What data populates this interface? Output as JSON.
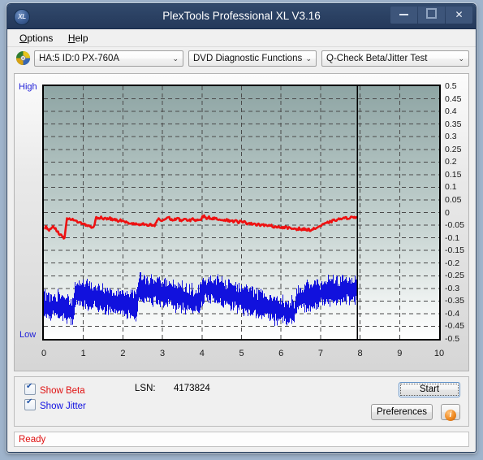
{
  "window": {
    "title": "PlexTools Professional XL V3.16",
    "app_icon": "xl-logo-icon",
    "minimize_label": "minimize",
    "maximize_label": "maximize",
    "close_label": "✕"
  },
  "menu": {
    "items": [
      {
        "label": "Options",
        "mnemonic": "O"
      },
      {
        "label": "Help",
        "mnemonic": "H"
      }
    ]
  },
  "toolbar": {
    "disc_icon": "disc-icon",
    "drive": {
      "value": "HA:5 ID:0  PX-760A",
      "arrow": "⌄"
    },
    "function": {
      "value": "DVD Diagnostic Functions",
      "arrow": "⌄"
    },
    "test": {
      "value": "Q-Check Beta/Jitter Test",
      "arrow": "⌄"
    }
  },
  "controls": {
    "show_beta": {
      "label": "Show Beta",
      "checked": true,
      "color": "#e01010"
    },
    "show_jitter": {
      "label": "Show Jitter",
      "checked": true,
      "color": "#1010e0"
    },
    "lsn_label": "LSN:",
    "lsn_value": "4173824",
    "start_label": "Start",
    "preferences_label": "Preferences",
    "info_label": "i"
  },
  "status": {
    "text": "Ready",
    "color": "#e01010"
  },
  "chart_data": {
    "type": "line",
    "title": "Q-Check Beta/Jitter Test",
    "xlabel": "",
    "ylabel": "",
    "xlim": [
      0,
      10
    ],
    "ylim": [
      -0.5,
      0.5
    ],
    "grid": true,
    "legend_position": "bottom-left",
    "axis_high_label": "High",
    "axis_low_label": "Low",
    "cursor_x": 7.93,
    "x_ticks": [
      "0",
      "1",
      "2",
      "3",
      "4",
      "5",
      "6",
      "7",
      "8",
      "9",
      "10"
    ],
    "y_ticks": [
      "0.5",
      "0.45",
      "0.4",
      "0.35",
      "0.3",
      "0.25",
      "0.2",
      "0.15",
      "0.1",
      "0.05",
      "0",
      "-0.05",
      "-0.1",
      "-0.15",
      "-0.2",
      "-0.25",
      "-0.3",
      "-0.35",
      "-0.4",
      "-0.45",
      "-0.5"
    ],
    "series": [
      {
        "name": "Beta",
        "color": "#ee1111",
        "x_start": 0.0,
        "x_end": 7.93,
        "values": [
          -0.062,
          -0.055,
          -0.071,
          -0.062,
          -0.052,
          -0.066,
          -0.078,
          -0.086,
          -0.095,
          -0.101,
          -0.027,
          -0.022,
          -0.026,
          -0.031,
          -0.034,
          -0.037,
          -0.04,
          -0.044,
          -0.048,
          -0.051,
          -0.054,
          -0.057,
          -0.059,
          -0.02,
          -0.023,
          -0.018,
          -0.024,
          -0.021,
          -0.026,
          -0.022,
          -0.028,
          -0.026,
          -0.031,
          -0.034,
          -0.03,
          -0.036,
          -0.038,
          -0.041,
          -0.042,
          -0.044,
          -0.045,
          -0.047,
          -0.048,
          -0.049,
          -0.046,
          -0.05,
          -0.052,
          -0.048,
          -0.051,
          -0.053,
          -0.03,
          -0.026,
          -0.033,
          -0.029,
          -0.024,
          -0.018,
          -0.026,
          -0.031,
          -0.027,
          -0.023,
          -0.028,
          -0.032,
          -0.025,
          -0.03,
          -0.034,
          -0.029,
          -0.024,
          -0.031,
          -0.028,
          -0.034,
          -0.018,
          -0.014,
          -0.022,
          -0.019,
          -0.025,
          -0.021,
          -0.027,
          -0.024,
          -0.029,
          -0.026,
          -0.031,
          -0.028,
          -0.034,
          -0.03,
          -0.036,
          -0.033,
          -0.038,
          -0.035,
          -0.04,
          -0.037,
          -0.043,
          -0.04,
          -0.046,
          -0.042,
          -0.048,
          -0.045,
          -0.051,
          -0.047,
          -0.053,
          -0.05,
          -0.055,
          -0.052,
          -0.057,
          -0.054,
          -0.059,
          -0.056,
          -0.061,
          -0.058,
          -0.063,
          -0.06,
          -0.065,
          -0.062,
          -0.066,
          -0.063,
          -0.068,
          -0.065,
          -0.069,
          -0.066,
          -0.07,
          -0.067,
          -0.063,
          -0.059,
          -0.055,
          -0.051,
          -0.047,
          -0.043,
          -0.039,
          -0.036,
          -0.033,
          -0.03,
          -0.028,
          -0.026,
          -0.024,
          -0.023,
          -0.022,
          -0.021,
          -0.02,
          -0.019,
          -0.018,
          -0.017
        ]
      },
      {
        "name": "Jitter",
        "color": "#1111dd",
        "x_start": 0.0,
        "x_end": 7.93,
        "band_center": [
          -0.368,
          -0.366,
          -0.37,
          -0.372,
          -0.369,
          -0.374,
          -0.378,
          -0.381,
          -0.384,
          -0.388,
          -0.318,
          -0.316,
          -0.32,
          -0.323,
          -0.326,
          -0.329,
          -0.332,
          -0.335,
          -0.338,
          -0.341,
          -0.344,
          -0.347,
          -0.35,
          -0.352,
          -0.355,
          -0.357,
          -0.359,
          -0.361,
          -0.363,
          -0.365,
          -0.3,
          -0.298,
          -0.302,
          -0.305,
          -0.308,
          -0.311,
          -0.314,
          -0.317,
          -0.32,
          -0.323,
          -0.326,
          -0.329,
          -0.332,
          -0.335,
          -0.338,
          -0.341,
          -0.344,
          -0.347,
          -0.35,
          -0.352,
          -0.31,
          -0.305,
          -0.3,
          -0.303,
          -0.307,
          -0.311,
          -0.315,
          -0.319,
          -0.323,
          -0.327,
          -0.331,
          -0.335,
          -0.339,
          -0.343,
          -0.347,
          -0.351,
          -0.355,
          -0.359,
          -0.363,
          -0.367,
          -0.371,
          -0.375,
          -0.379,
          -0.383,
          -0.386,
          -0.389,
          -0.392,
          -0.394,
          -0.396,
          -0.398,
          -0.345,
          -0.341,
          -0.337,
          -0.333,
          -0.33,
          -0.327,
          -0.324,
          -0.321,
          -0.318,
          -0.316,
          -0.314,
          -0.312,
          -0.31,
          -0.309,
          -0.308,
          -0.307,
          -0.306,
          -0.306,
          -0.305,
          -0.305
        ],
        "band_halfwidth": 0.045,
        "description": "Dense noisy jitter band oscillating roughly between -0.25 and -0.45"
      }
    ]
  }
}
